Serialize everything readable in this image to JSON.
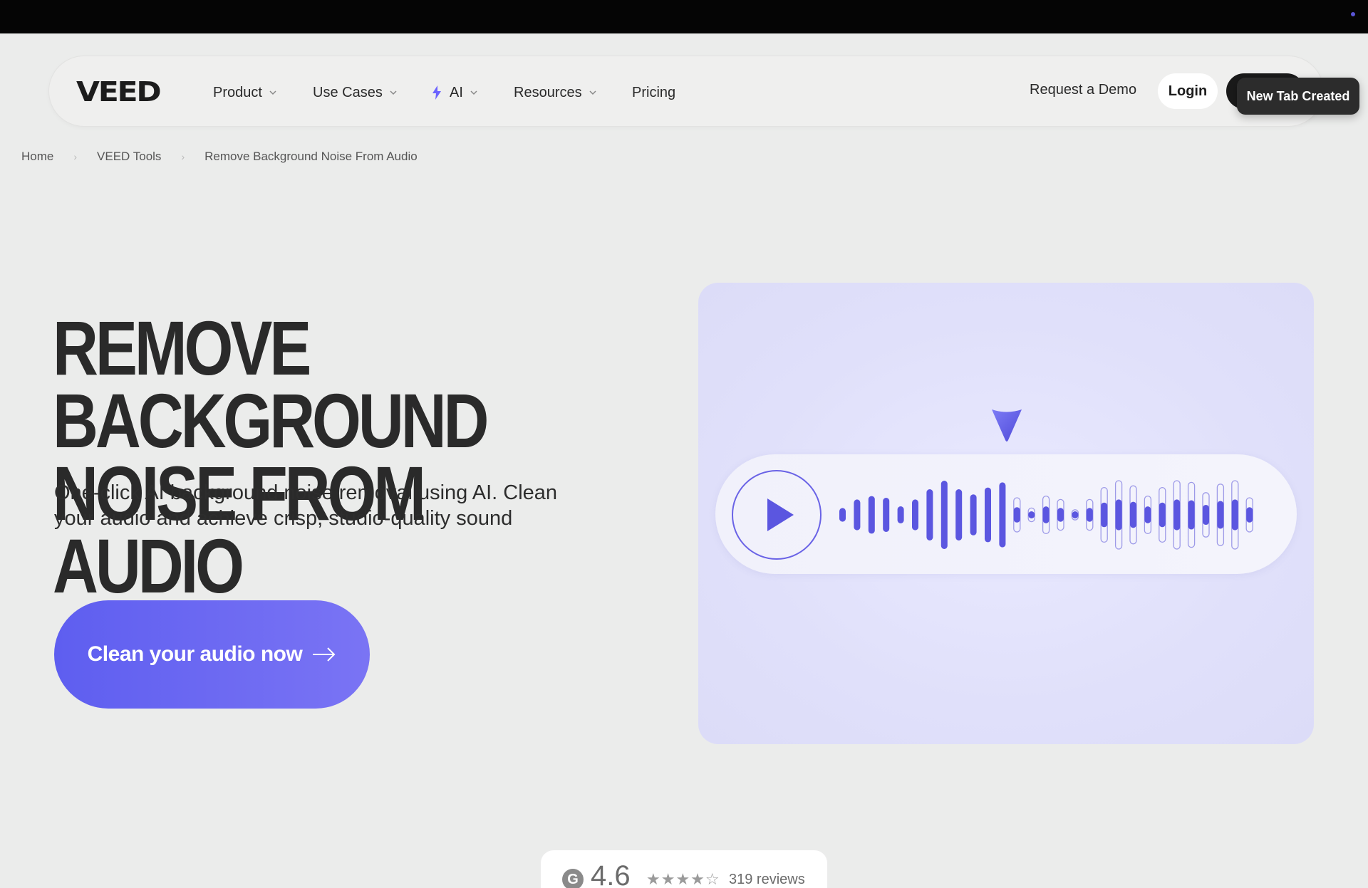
{
  "nav": {
    "logo": "VEED",
    "items": [
      {
        "label": "Product",
        "has_dropdown": true
      },
      {
        "label": "Use Cases",
        "has_dropdown": true
      },
      {
        "label": "AI",
        "has_dropdown": true
      },
      {
        "label": "Resources",
        "has_dropdown": true
      },
      {
        "label": "Pricing",
        "has_dropdown": false
      }
    ],
    "request_demo": "Request a Demo",
    "login": "Login"
  },
  "toast": {
    "text": "New Tab Created"
  },
  "breadcrumb": [
    "Home",
    "VEED Tools",
    "Remove Background Noise From Audio"
  ],
  "hero": {
    "title_line1": "REMOVE BACKGROUND",
    "title_line2": "NOISE FROM AUDIO",
    "subtitle": "One-click AI background noise removal using AI. Clean your audio and achieve crisp, studio-quality sound",
    "cta": "Clean your audio now"
  },
  "player": {
    "icon": "play-icon",
    "waveform_levels_filled": [
      0.2,
      0.45,
      0.55,
      0.5,
      0.25,
      0.45,
      0.75,
      1.0,
      0.75,
      0.6,
      0.8,
      0.95
    ],
    "waveform_levels_outline": [
      0.5,
      0.2,
      0.55,
      0.45,
      0.15,
      0.45,
      0.8,
      1.0,
      0.85,
      0.55,
      0.8,
      1.0,
      0.95,
      0.65,
      0.9,
      1.0,
      0.5
    ]
  },
  "rating": {
    "score": "4.6",
    "stars": "★★★★☆",
    "reviews": "319 reviews"
  },
  "colors": {
    "accent": "#5e5ef0",
    "wave": "#5b56e0",
    "card": "#e0e0fa"
  }
}
